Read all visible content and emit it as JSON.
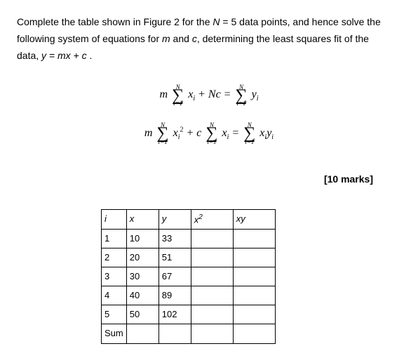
{
  "prompt": {
    "line1_a": "Complete the table shown in Figure 2 for the ",
    "line1_b": "N",
    "line1_c": " = 5 data points, and hence solve the",
    "line2_a": "following system of equations for ",
    "line2_b": "m",
    "line2_c": " and ",
    "line2_d": "c",
    "line2_e": ", determining the least squares fit of the",
    "line3_a": "data,  ",
    "line3_b": "y = mx + c",
    "line3_c": " ."
  },
  "equations": {
    "sum_upper": "N",
    "sum_lower": "i=1",
    "eq1_lhs_m": "m",
    "eq1_term1": "x",
    "eq1_term1_sub": "i",
    "eq1_plus": " + ",
    "eq1_Nc": "Nc",
    "eq1_eq": " = ",
    "eq1_rhs": "y",
    "eq1_rhs_sub": "i",
    "eq2_lhs_m": "m",
    "eq2_t1": "x",
    "eq2_t1_sub": "i",
    "eq2_t1_sup": "2",
    "eq2_plus": " + ",
    "eq2_c": "c",
    "eq2_t2": "x",
    "eq2_t2_sub": "i",
    "eq2_eq": " = ",
    "eq2_rhs1": "x",
    "eq2_rhs1_sub": "i",
    "eq2_rhs2": "y",
    "eq2_rhs2_sub": "i"
  },
  "marks": "[10 marks]",
  "table": {
    "headers": {
      "i": "i",
      "x": "x",
      "y": "y",
      "x2": "x",
      "x2_sup": "2",
      "xy": "xy"
    },
    "rows": [
      {
        "i": "1",
        "x": "10",
        "y": "33"
      },
      {
        "i": "2",
        "x": "20",
        "y": "51"
      },
      {
        "i": "3",
        "x": "30",
        "y": "67"
      },
      {
        "i": "4",
        "x": "40",
        "y": "89"
      },
      {
        "i": "5",
        "x": "50",
        "y": "102"
      }
    ],
    "sum_label": "Sum"
  }
}
